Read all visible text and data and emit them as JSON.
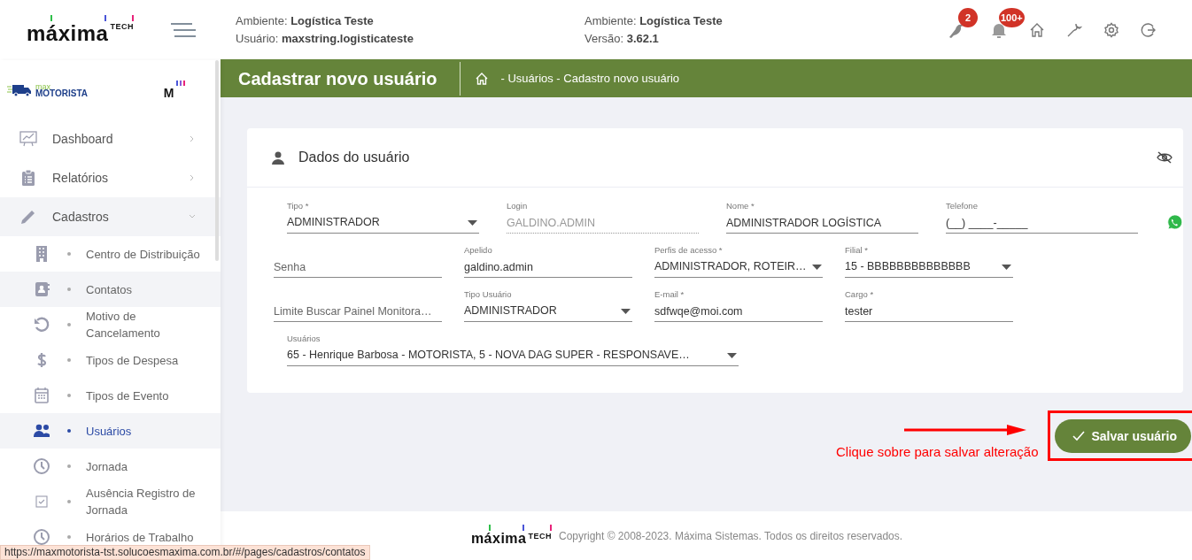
{
  "header": {
    "logo": {
      "brand": "máxima",
      "suffix": "TECH"
    },
    "info_blocks": [
      [
        "Ambiente: **Logística Teste**",
        "Usuário: **maxstring.logisticateste**"
      ],
      [
        "Ambiente: **Logística Teste**",
        "Versão: **3.62.1**"
      ]
    ],
    "notifications": [
      {
        "badge": "2"
      },
      {
        "badge": "100+"
      }
    ]
  },
  "sidebar": {
    "brand": {
      "small": "max",
      "large": "MOTORISTA",
      "mark": "M"
    },
    "items": [
      {
        "label": "Dashboard",
        "expanded": false
      },
      {
        "label": "Relatórios",
        "expanded": false
      },
      {
        "label": "Cadastros",
        "expanded": true,
        "children": [
          {
            "label": "Centro de Distribuição",
            "selected": false,
            "hovered": false
          },
          {
            "label": "Contatos",
            "selected": false,
            "hovered": true
          },
          {
            "label": "Motivo de Cancelamento",
            "selected": false,
            "hovered": false
          },
          {
            "label": "Tipos de Despesa",
            "selected": false,
            "hovered": false
          },
          {
            "label": "Tipos de Evento",
            "selected": false,
            "hovered": false
          },
          {
            "label": "Usuários",
            "selected": true,
            "hovered": false
          },
          {
            "label": "Jornada",
            "selected": false,
            "hovered": false
          },
          {
            "label": "Ausência Registro de Jornada",
            "selected": false,
            "hovered": false
          },
          {
            "label": "Horários de Trabalho",
            "selected": false,
            "hovered": false
          }
        ]
      }
    ]
  },
  "page": {
    "title": "Cadastrar novo usuário",
    "breadcrumb": "- Usuários - Cadastro novo usuário"
  },
  "card": {
    "title": "Dados do usuário",
    "rows": [
      [
        {
          "kind": "select",
          "label": "Tipo *",
          "value": "ADMINISTRADOR"
        },
        {
          "kind": "readonly",
          "label": "Login",
          "value": "GALDINO.ADMIN"
        },
        {
          "kind": "text",
          "label": "Nome *",
          "value": "ADMINISTRADOR LOGÍSTICA"
        },
        {
          "kind": "phone",
          "label": "Telefone",
          "value": "(__) ____-_____"
        }
      ],
      [
        {
          "kind": "text",
          "placeholder": "Senha"
        },
        {
          "kind": "text",
          "label": "Apelido",
          "value": "galdino.admin"
        },
        {
          "kind": "select",
          "label": "Perfis de acesso *",
          "value": "ADMINISTRADOR, ROTEIR…"
        },
        {
          "kind": "select",
          "label": "Filial *",
          "value": "15 - BBBBBBBBBBBBBB"
        }
      ],
      [
        {
          "kind": "text",
          "placeholder": "Limite Buscar Painel Monitora…"
        },
        {
          "kind": "select",
          "label": "Tipo Usuário",
          "value": "ADMINISTRADOR"
        },
        {
          "kind": "text",
          "label": "E-mail *",
          "value": "sdfwqe@moi.com"
        },
        {
          "kind": "text",
          "label": "Cargo *",
          "value": "tester"
        }
      ],
      [
        {
          "kind": "select",
          "label": "Usuários",
          "value": "65 - Henrique Barbosa - MOTORISTA, 5 - NOVA DAG SUPER - RESPONSAVE…"
        }
      ]
    ]
  },
  "save_button": "Salvar usuário",
  "annotation": "Clique sobre para salvar alteração",
  "footer": {
    "logo": {
      "brand": "máxima",
      "suffix": "TECH"
    },
    "copyright": "Copyright © 2008-2023. Máxima Sistemas. Todos os direitos reservados."
  },
  "status_url": "https://maxmotorista-tst.solucoesmaxima.com.br/#/pages/cadastros/contatos"
}
